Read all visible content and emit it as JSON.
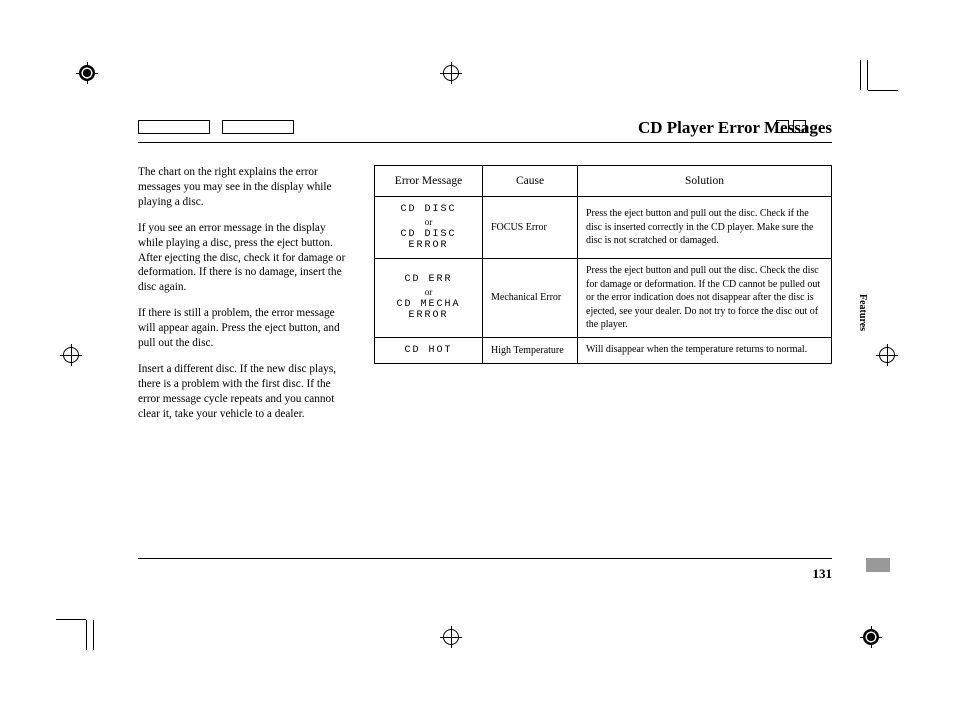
{
  "title": "CD Player Error Messages",
  "side_tab": "Features",
  "page_number": "131",
  "paragraphs": [
    "The chart on the right explains the error messages you may see in the display while playing a disc.",
    "If you see an error message in the display while playing a disc, press the eject button. After ejecting the disc, check it for damage or deformation. If there is no damage, insert the disc again.",
    "If there is still a problem, the error message will appear again. Press the eject button, and pull out the disc.",
    "Insert a different disc. If the new disc plays, there is a problem with the first disc. If the error message cycle repeats and you cannot clear it, take your vehicle to a dealer."
  ],
  "table": {
    "headers": [
      "Error Message",
      "Cause",
      "Solution"
    ],
    "rows": [
      {
        "msg_line1": "CD DISC",
        "or": "or",
        "msg_line2": "CD DISC ERROR",
        "cause": "FOCUS Error",
        "solution": "Press the eject button and pull out the disc. Check if the disc is inserted correctly in the CD player.\nMake sure the disc is not scratched or damaged."
      },
      {
        "msg_line1": "CD ERR",
        "or": "or",
        "msg_line2": "CD MECHA ERROR",
        "cause": "Mechanical Error",
        "solution": "Press the eject button and pull out the disc. Check the disc for damage or deformation.\nIf the CD cannot be pulled out or the error indication does not disappear after the disc is ejected, see your dealer.\nDo not try to force the disc out of the player."
      },
      {
        "msg_line1": "CD HOT",
        "or": "",
        "msg_line2": "",
        "cause": "High Temperature",
        "solution": "Will disappear when the temperature returns to normal."
      }
    ]
  }
}
